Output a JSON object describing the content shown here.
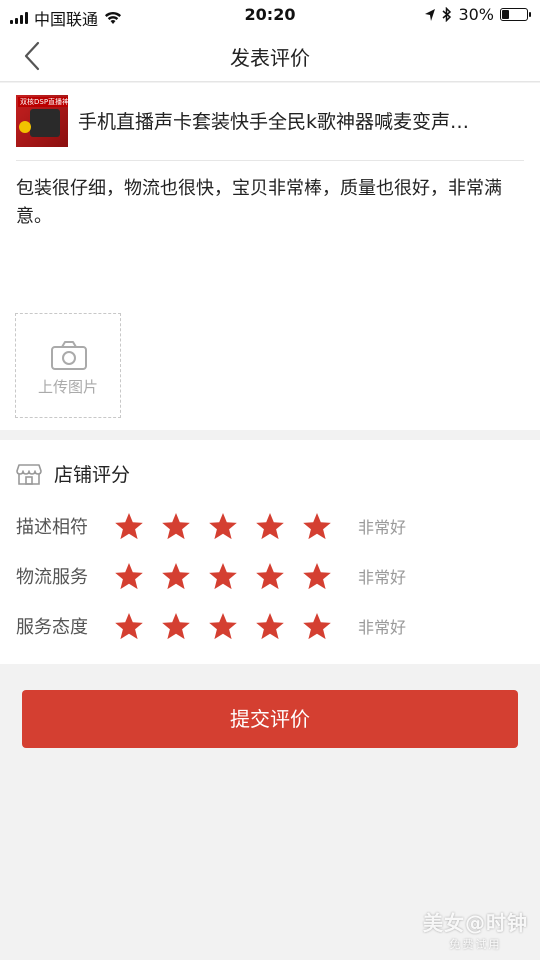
{
  "status_bar": {
    "carrier": "中国联通",
    "time": "20:20",
    "battery_percent": "30%",
    "battery_level": 0.3
  },
  "nav": {
    "back_icon": "chevron-left-icon",
    "title": "发表评价"
  },
  "product": {
    "thumb_text": "双核DSP直播神器",
    "name": "手机直播声卡套装快手全民k歌神器喊麦变声…"
  },
  "review": {
    "text": "包装很仔细，物流也很快，宝贝非常棒，质量也很好，非常满意。"
  },
  "upload": {
    "icon": "camera-icon",
    "label": "上传图片"
  },
  "shop_rating": {
    "icon": "shop-icon",
    "title": "店铺评分",
    "rows": [
      {
        "label": "描述相符",
        "stars": 5,
        "text": "非常好"
      },
      {
        "label": "物流服务",
        "stars": 5,
        "text": "非常好"
      },
      {
        "label": "服务态度",
        "stars": 5,
        "text": "非常好"
      }
    ]
  },
  "submit": {
    "label": "提交评价"
  },
  "watermark": {
    "main": "美女@时钟",
    "sub": "免费试用"
  },
  "colors": {
    "accent": "#d43f31",
    "star": "#d43f31",
    "background": "#f2f2f2"
  }
}
